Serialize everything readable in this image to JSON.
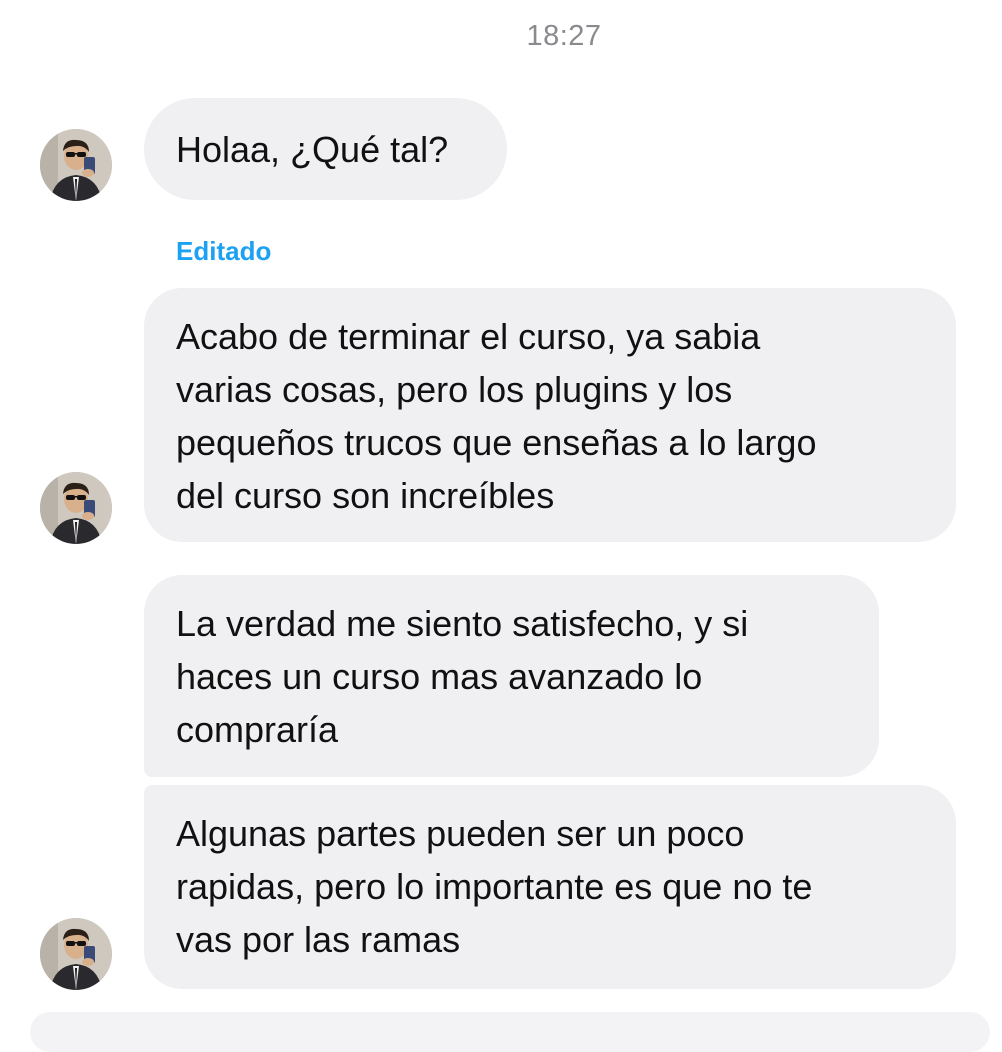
{
  "chat": {
    "timestamp": "18:27",
    "edited_label": "Editado",
    "messages": [
      {
        "text": "Holaa, ¿Qué tal?"
      },
      {
        "text": "Acabo de terminar el curso, ya  sabia\nvarias cosas, pero los plugins y los\npequeños trucos que enseñas a lo largo\ndel curso son increíbles"
      },
      {
        "text": "La verdad me siento satisfecho, y si\nhaces un curso mas avanzado lo\ncompraría"
      },
      {
        "text": "Algunas partes pueden ser un poco\nrapidas, pero lo importante es que no te\nvas por las ramas"
      }
    ]
  },
  "colors": {
    "bubble_background": "#f0f0f2",
    "edited_label": "#1da1f2",
    "timestamp": "#8a8a8e"
  },
  "icons": {
    "avatar": "profile-photo-avatar"
  }
}
